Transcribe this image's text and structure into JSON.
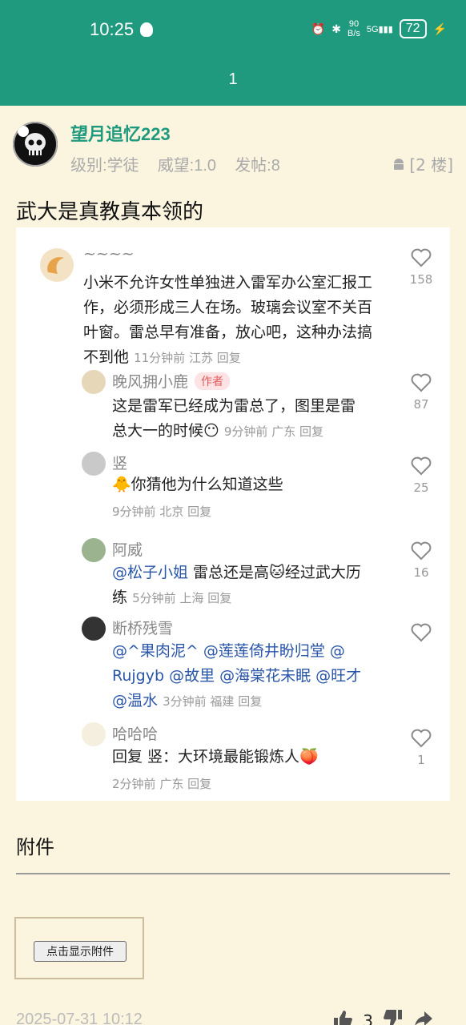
{
  "status": {
    "time": "10:25",
    "net_speed_top": "90",
    "net_speed_bottom": "B/s",
    "signal": "5G",
    "battery": "72"
  },
  "titlebar": {
    "title": "1"
  },
  "author": {
    "name": "望月追忆223",
    "level_label": "级别:",
    "level": "学徒",
    "prestige_label": "威望:",
    "prestige": "1.0",
    "posts_label": "发帖:",
    "posts": "8",
    "floor": "[2 楼]"
  },
  "post": {
    "title": "武大是真教真本领的"
  },
  "comments": [
    {
      "name": "~~~~",
      "text": "小米不允许女性单独进入雷军办公室汇报工作，必须形成三人在场。玻璃会议室不关百叶窗。雷总早有准备，放心吧，这种办法搞不到他",
      "time": "11分钟前",
      "loc": "江苏",
      "reply": "回复",
      "likes": "158"
    },
    {
      "name": "晚风拥小鹿",
      "tag": "作者",
      "text1": "这是雷军已经成为雷总了，图里是雷",
      "text2": "总大一的时候",
      "time": "9分钟前",
      "loc": "广东",
      "reply": "回复",
      "likes": "87"
    },
    {
      "name": "竖",
      "text": "你猜他为什么知道这些",
      "time": "9分钟前",
      "loc": "北京",
      "reply": "回复",
      "likes": "25"
    },
    {
      "name": "阿威",
      "mention": "@松子小姐",
      "text1": " 雷总还是高",
      "text2": "经过武大历",
      "text3": "练",
      "time": "5分钟前",
      "loc": "上海",
      "reply": "回复",
      "likes": "16"
    },
    {
      "name": "断桥残雪",
      "line1": "@^果肉泥^  @莲莲倚井盼归堂  @",
      "line2": "Rujgyb  @故里  @海棠花未眠  @旺才",
      "line3": "@温水",
      "time": "3分钟前",
      "loc": "福建",
      "reply": "回复",
      "likes": ""
    },
    {
      "name": "哈哈哈",
      "text": "回复  竖：大环境最能锻炼人",
      "time": "2分钟前",
      "loc": "广东",
      "reply": "回复",
      "likes": "1"
    }
  ],
  "attachments": {
    "title": "附件",
    "button": "点击显示附件"
  },
  "footer": {
    "date": "2025-07-31 10:12",
    "up_count": "3"
  }
}
